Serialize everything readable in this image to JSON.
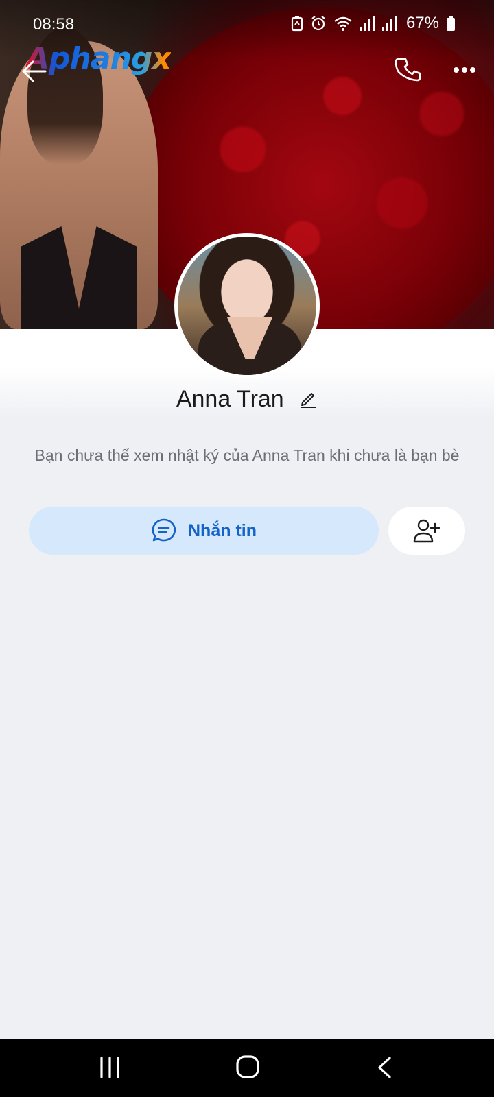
{
  "status_bar": {
    "time": "08:58",
    "battery": "67%",
    "icons": [
      "battery-saver-icon",
      "alarm-icon",
      "wifi-icon",
      "signal-icon",
      "signal-icon",
      "battery-icon"
    ]
  },
  "header": {
    "logo_text": "Aphangx",
    "back_icon": "arrow-left-icon",
    "call_icon": "phone-icon",
    "more_icon": "more-horizontal-icon"
  },
  "profile": {
    "name": "Anna Tran",
    "notice": "Bạn chưa thể xem nhật ký của Anna Tran khi chưa là bạn bè"
  },
  "actions": {
    "message_label": "Nhắn tin",
    "message_icon": "chat-bubble-icon",
    "add_friend_icon": "add-friend-icon"
  },
  "colors": {
    "accent": "#1463c8",
    "message_button_bg": "#d6e8fc",
    "page_bg": "#eff0f4"
  }
}
